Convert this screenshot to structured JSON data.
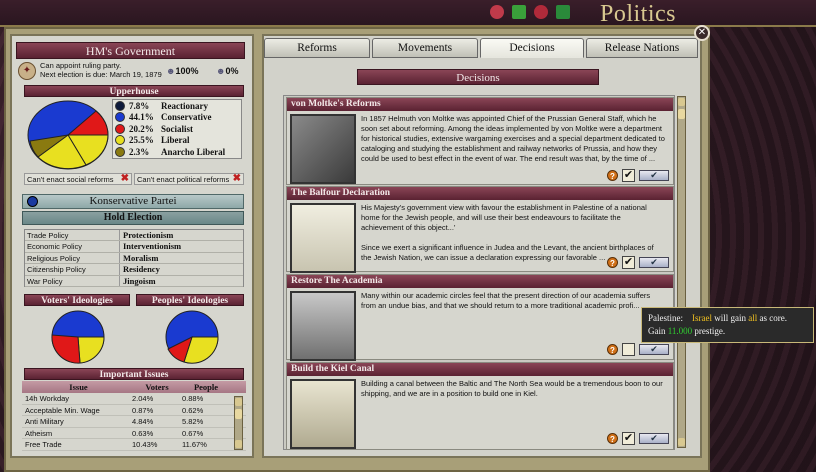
{
  "window": {
    "title": "Politics"
  },
  "left": {
    "gov_title": "HM's Government",
    "gov_line1": "Can appoint ruling party.",
    "gov_line2": "Next election is due: March 19, 1879",
    "stat1": "100%",
    "stat2": "0%",
    "upperhouse": "Upperhouse",
    "upper_legend": [
      {
        "pct": "7.8%",
        "name": "Reactionary",
        "color": "#0d1a3a"
      },
      {
        "pct": "44.1%",
        "name": "Conservative",
        "color": "#1a3ad0"
      },
      {
        "pct": "20.2%",
        "name": "Socialist",
        "color": "#e01818"
      },
      {
        "pct": "25.5%",
        "name": "Liberal",
        "color": "#e8e020"
      },
      {
        "pct": "2.3%",
        "name": "Anarcho Liberal",
        "color": "#8a7a10"
      }
    ],
    "cant_social": "Can't enact social reforms",
    "cant_political": "Can't enact political reforms",
    "party_name": "Konservative Partei",
    "hold_election": "Hold Election",
    "policies": [
      {
        "k": "Trade Policy",
        "v": "Protectionism"
      },
      {
        "k": "Economic Policy",
        "v": "Interventionism"
      },
      {
        "k": "Religious Policy",
        "v": "Moralism"
      },
      {
        "k": "Citizenship Policy",
        "v": "Residency"
      },
      {
        "k": "War Policy",
        "v": "Jingoism"
      }
    ],
    "voters_ideologies": "Voters' Ideologies",
    "peoples_ideologies": "Peoples' Ideologies",
    "important_issues": "Important Issues",
    "issue_cols": {
      "issue": "Issue",
      "voters": "Voters",
      "people": "People"
    },
    "issues": [
      {
        "issue": "14h Workday",
        "voters": "2.04%",
        "people": "0.88%"
      },
      {
        "issue": "Acceptable Min. Wage",
        "voters": "0.87%",
        "people": "0.62%"
      },
      {
        "issue": "Anti Military",
        "voters": "4.84%",
        "people": "5.82%"
      },
      {
        "issue": "Atheism",
        "voters": "0.63%",
        "people": "0.67%"
      },
      {
        "issue": "Free Trade",
        "voters": "10.43%",
        "people": "11.67%"
      }
    ]
  },
  "tabs": [
    "Reforms",
    "Movements",
    "Decisions",
    "Release Nations"
  ],
  "decisions_header": "Decisions",
  "decisions": [
    {
      "title": "von Moltke's Reforms",
      "desc": "In 1857 Helmuth von Moltke was appointed Chief of the Prussian General Staff, which he soon set about reforming. Among the ideas implemented by von Moltke were a department for historical studies, extensive wargaming exercises and a special department dedicated to cataloging and studying the establishment and railway networks of Prussia, and how they could be used to best effect in the event of war. The end result was that, by the time of ...",
      "checked": true
    },
    {
      "title": "The Balfour Declaration",
      "desc": "His Majesty's government view with favour the establishment in Palestine of a national home for the Jewish people, and will use their best endeavours to facilitate the achievement of this object...'\n\nSince we exert a significant influence in Judea and the Levant, the ancient birthplaces of the Jewish Nation, we can issue a declaration expressing our favorable ...",
      "checked": true
    },
    {
      "title": "Restore The Academia",
      "desc": "Many within our academic circles feel that the present direction of our academia suffers from an undue bias, and that we should return to a more traditional academic profi...",
      "checked": false
    },
    {
      "title": "Build the Kiel Canal",
      "desc": "Building a canal between the Baltic and The North Sea would be a tremendous boon to our shipping, and we are in a position to build one in Kiel.",
      "checked": true
    }
  ],
  "tooltip": {
    "l1a": "Palestine:",
    "l1b": "Israel",
    "l1c": " will gain ",
    "l1d": "all",
    "l1e": " as core.",
    "l2a": "Gain ",
    "l2b": "11.000",
    "l2c": " prestige."
  },
  "colors": {
    "reactionary": "#0d1a3a",
    "conservative": "#1a3ad0",
    "socialist": "#e01818",
    "liberal": "#e8e020",
    "anarcho_liberal": "#8a7a10"
  }
}
